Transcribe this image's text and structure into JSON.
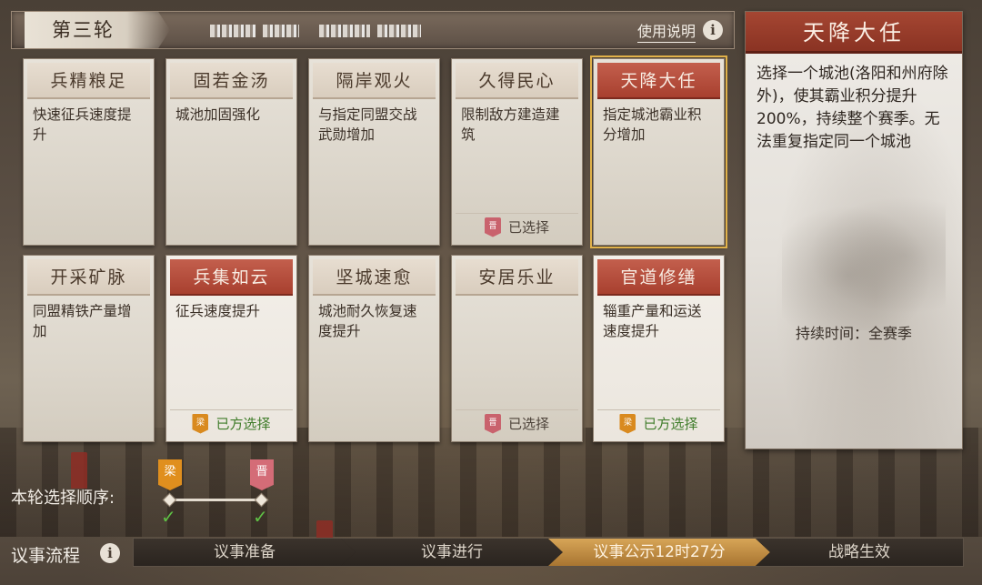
{
  "header": {
    "round_title": "第三轮",
    "usage_link": "使用说明",
    "info_glyph": "i"
  },
  "cards": [
    {
      "title": "兵精粮足",
      "desc": "快速征兵速度提升",
      "footer": ""
    },
    {
      "title": "固若金汤",
      "desc": "城池加固强化",
      "footer": ""
    },
    {
      "title": "隔岸观火",
      "desc": "与指定同盟交战武勋增加",
      "footer": ""
    },
    {
      "title": "久得民心",
      "desc": "限制敌方建造建筑",
      "footer": "已选择",
      "seal": "晋"
    },
    {
      "title": "天降大任",
      "desc": "指定城池霸业积分增加",
      "footer": ""
    },
    {
      "title": "开采矿脉",
      "desc": "同盟精铁产量增加",
      "footer": ""
    },
    {
      "title": "兵集如云",
      "desc": "征兵速度提升",
      "footer": "已方选择",
      "seal": "梁"
    },
    {
      "title": "坚城速愈",
      "desc": "城池耐久恢复速度提升",
      "footer": ""
    },
    {
      "title": "安居乐业",
      "desc": "",
      "footer": "已选择",
      "seal": "晋"
    },
    {
      "title": "官道修缮",
      "desc": "辎重产量和运送速度提升",
      "footer": "已方选择",
      "seal": "梁"
    }
  ],
  "detail": {
    "title": "天降大任",
    "description": "选择一个城池(洛阳和州府除外)，使其霸业积分提升200%，持续整个赛季。无法重复指定同一个城池",
    "duration": "持续时间：全赛季"
  },
  "selection_order": {
    "label": "本轮选择顺序:",
    "first_flag": "梁",
    "second_flag": "晋",
    "check": "✓"
  },
  "process": {
    "label": "议事流程",
    "info_glyph": "i",
    "steps": [
      "议事准备",
      "议事进行",
      "议事公示12时27分",
      "战略生效"
    ]
  },
  "colors": {
    "active_step": "#d7a557",
    "own_selected": "#3f7c2a",
    "title_red": "#a8402f",
    "highlight_outline": "#e1b24a"
  }
}
